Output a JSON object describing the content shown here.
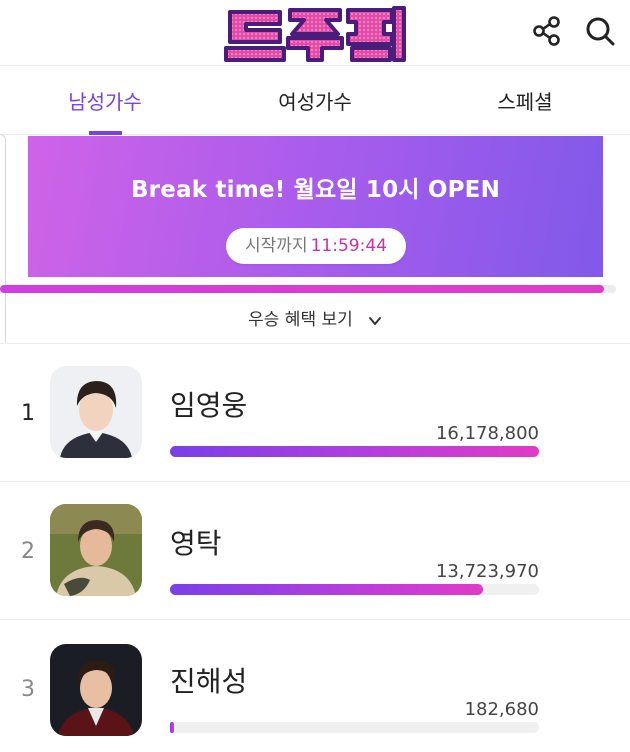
{
  "header": {
    "logo_text": "트롯픽",
    "share_icon": "share-icon",
    "search_icon": "search-icon"
  },
  "tabs": [
    {
      "label": "남성가수",
      "active": true
    },
    {
      "label": "여성가수",
      "active": false
    },
    {
      "label": "스페셜",
      "active": false
    }
  ],
  "banner": {
    "title": "Break time! 월요일 10시 OPEN",
    "timer_label": "시작까지",
    "timer_value": "11:59:44"
  },
  "timeline_progress": 0.98,
  "benefit": {
    "label": "우승 혜택 보기",
    "icon": "chevron-down-icon"
  },
  "ranking": [
    {
      "rank": "1",
      "name": "임영웅",
      "votes": "16,178,800",
      "progress": 1.0
    },
    {
      "rank": "2",
      "name": "영탁",
      "votes": "13,723,970",
      "progress": 0.848
    },
    {
      "rank": "3",
      "name": "진해성",
      "votes": "182,680",
      "progress": 0.011
    }
  ],
  "colors": {
    "accent": "#7b3fe4",
    "banner_start": "#cf63e8",
    "banner_end": "#8159ea",
    "timer": "#cc2ea8",
    "bar_start": "#7a3fe8",
    "bar_end": "#e33ac8"
  }
}
